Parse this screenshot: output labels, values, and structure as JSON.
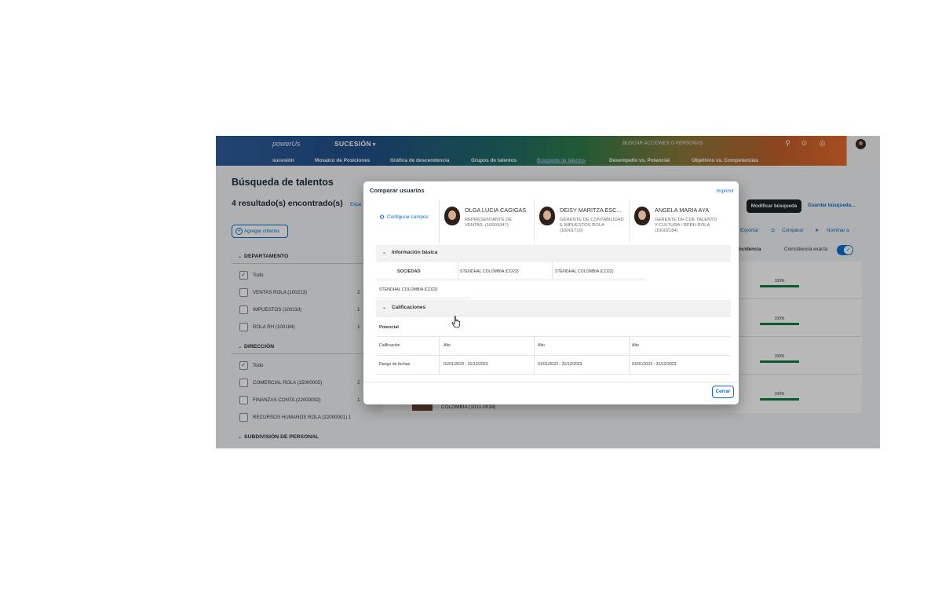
{
  "header": {
    "logo": "powerUs",
    "app_title": "SUCESIÓN",
    "search_placeholder": "BUSCAR ACCIONES O PERSONAS",
    "tabs": [
      "sucesión",
      "Mosaico de Posiciones",
      "Gráfica de descendencia",
      "Grupos de talentos",
      "Búsqueda de talentos",
      "Desempeño vs. Potencial",
      "Objetivos vs. Competencias"
    ],
    "active_tab": "Búsqueda de talentos"
  },
  "page": {
    "title": "Búsqueda de talentos",
    "result_count": "4 resultado(s) encontrado(s)",
    "expand_link": "Expa",
    "add_criteria": "Agregar criterios",
    "modify_search": "Modificar búsqueda",
    "save_search": "Guardar búsqueda...",
    "actions": [
      "Exportar",
      "Comparar",
      "Nominar a"
    ],
    "col_match": "ncidencia",
    "exact_match": "Coincidencia exacta",
    "bottom_text": "COLOMBIA (1011-0018)"
  },
  "filters": [
    {
      "title": "DEPARTAMENTO",
      "items": [
        {
          "label": "Todo",
          "count": "",
          "checked": true
        },
        {
          "label": "VENTAS ROLA (100213)",
          "count": "2",
          "checked": false
        },
        {
          "label": "IMPUESTOS (100119)",
          "count": "1",
          "checked": false
        },
        {
          "label": "ROLA RH (100184)",
          "count": "1",
          "checked": false
        }
      ]
    },
    {
      "title": "DIRECCIÓN",
      "items": [
        {
          "label": "Todo",
          "count": "",
          "checked": true
        },
        {
          "label": "COMERCIAL ROLA (15000005)",
          "count": "2",
          "checked": false
        },
        {
          "label": "FINANZAS CONTA (22000002)",
          "count": "1",
          "checked": false
        },
        {
          "label": "RECURSOS HUMANOS ROLA (22000001) 1",
          "count": "",
          "checked": false
        }
      ]
    },
    {
      "title": "SUBDIVISIÓN DE PERSONAL",
      "items": []
    }
  ],
  "results": [
    {
      "match": "100%"
    },
    {
      "match": "100%"
    },
    {
      "match": "100%"
    },
    {
      "match": "100%"
    }
  ],
  "modal": {
    "title": "Comparar usuarios",
    "print": "Imprimir",
    "configure_fields": "Configurar campos",
    "close": "Cerrar",
    "people": [
      {
        "name": "OLGA LUCIA CAGIGAS",
        "role": "REPRESENTANTE DE VENTAS. (10001047)"
      },
      {
        "name": "DEISY MARITZA ESC...",
        "role": "GERENTE DE CONTABILIDAD E IMPUESTOS ROLA (10001710)"
      },
      {
        "name": "ANGELA MARIA AYA",
        "role": "GERENTE DE CDE TALENTO Y CULTURA / BPRH ROLA (10002184)"
      }
    ],
    "basic_info": {
      "heading": "Información básica",
      "field": "SOCIEDAD",
      "values": [
        "STENDHAL COLOMBIA (CO22)",
        "STENDHAL COLOMBIA (CO22)",
        "STENDHAL COLOMBIA (CO22)"
      ]
    },
    "ratings": {
      "heading": "Calificaciones",
      "group": "Potencial",
      "rows": [
        {
          "label": "Calificación",
          "values": [
            "Alto",
            "Alto",
            "Alto"
          ]
        },
        {
          "label": "Rango de fechas",
          "values": [
            "01/01/2023 - 31/12/2023",
            "01/01/2023 - 31/12/2023",
            "01/01/2023 - 31/12/2023"
          ]
        }
      ]
    }
  }
}
